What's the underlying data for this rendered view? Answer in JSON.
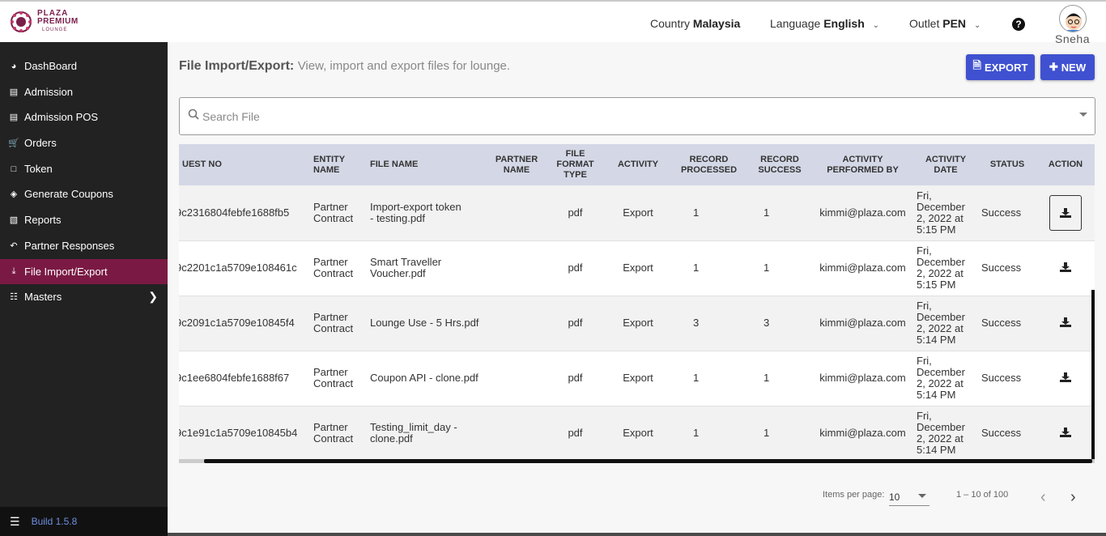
{
  "brand": {
    "line1": "PLAZA",
    "line2": "PREMIUM",
    "line3": "LOUNGE",
    "color": "#7a1e4a"
  },
  "header": {
    "country_label": "Country",
    "country_value": "Malaysia",
    "language_label": "Language",
    "language_value": "English",
    "outlet_label": "Outlet",
    "outlet_value": "PEN",
    "help_icon": "question-circle-icon",
    "user_name": "Sneha"
  },
  "sidebar": {
    "items": [
      {
        "label": "DashBoard",
        "icon": "dashboard-icon"
      },
      {
        "label": "Admission",
        "icon": "id-card-icon"
      },
      {
        "label": "Admission POS",
        "icon": "id-card-icon"
      },
      {
        "label": "Orders",
        "icon": "cart-icon"
      },
      {
        "label": "Token",
        "icon": "file-icon"
      },
      {
        "label": "Generate Coupons",
        "icon": "tag-icon"
      },
      {
        "label": "Reports",
        "icon": "book-icon"
      },
      {
        "label": "Partner Responses",
        "icon": "reply-icon"
      },
      {
        "label": "File Import/Export",
        "icon": "download-icon",
        "active": true
      },
      {
        "label": "Masters",
        "icon": "sitemap-icon"
      }
    ],
    "active_color": "#7a1a44",
    "build_label": "Build 1.5.8"
  },
  "page": {
    "title": "File Import/Export:",
    "subtitle": "View, import and export files for lounge.",
    "export_label": "EXPORT",
    "new_label": "NEW",
    "accent_color": "#3f51d0"
  },
  "search": {
    "placeholder": "Search File",
    "value": ""
  },
  "table": {
    "headers": [
      "UEST NO",
      "ENTITY NAME",
      "FILE NAME",
      "PARTNER NAME",
      "FILE FORMAT TYPE",
      "ACTIVITY",
      "RECORD PROCESSED",
      "RECORD SUCCESS",
      "ACTIVITY PERFORMED BY",
      "ACTIVITY DATE",
      "STATUS",
      "ACTION"
    ],
    "rows": [
      {
        "req": "9c2316804febfe1688fb5",
        "entity": "Partner Contract",
        "file": "Import-export token - testing.pdf",
        "partner": "",
        "format": "pdf",
        "activity": "Export",
        "processed": "1",
        "success": "1",
        "by": "kimmi@plaza.com",
        "date": "Fri, December 2, 2022 at 5:15 PM",
        "status": "Success"
      },
      {
        "req": "9c2201c1a5709e108461c",
        "entity": "Partner Contract",
        "file": "Smart Traveller Voucher.pdf",
        "partner": "",
        "format": "pdf",
        "activity": "Export",
        "processed": "1",
        "success": "1",
        "by": "kimmi@plaza.com",
        "date": "Fri, December 2, 2022 at 5:15 PM",
        "status": "Success"
      },
      {
        "req": "9c2091c1a5709e10845f4",
        "entity": "Partner Contract",
        "file": "Lounge Use - 5 Hrs.pdf",
        "partner": "",
        "format": "pdf",
        "activity": "Export",
        "processed": "3",
        "success": "3",
        "by": "kimmi@plaza.com",
        "date": "Fri, December 2, 2022 at 5:14 PM",
        "status": "Success"
      },
      {
        "req": "9c1ee6804febfe1688f67",
        "entity": "Partner Contract",
        "file": "Coupon API - clone.pdf",
        "partner": "",
        "format": "pdf",
        "activity": "Export",
        "processed": "1",
        "success": "1",
        "by": "kimmi@plaza.com",
        "date": "Fri, December 2, 2022 at 5:14 PM",
        "status": "Success"
      },
      {
        "req": "9c1e91c1a5709e10845b4",
        "entity": "Partner Contract",
        "file": "Testing_limit_day - clone.pdf",
        "partner": "",
        "format": "pdf",
        "activity": "Export",
        "processed": "1",
        "success": "1",
        "by": "kimmi@plaza.com",
        "date": "Fri, December 2, 2022 at 5:14 PM",
        "status": "Success"
      }
    ],
    "header_bg": "#d4d8e6"
  },
  "pagination": {
    "items_per_page_label": "Items per page:",
    "items_per_page_value": "10",
    "range_label": "1 – 10 of 100"
  }
}
